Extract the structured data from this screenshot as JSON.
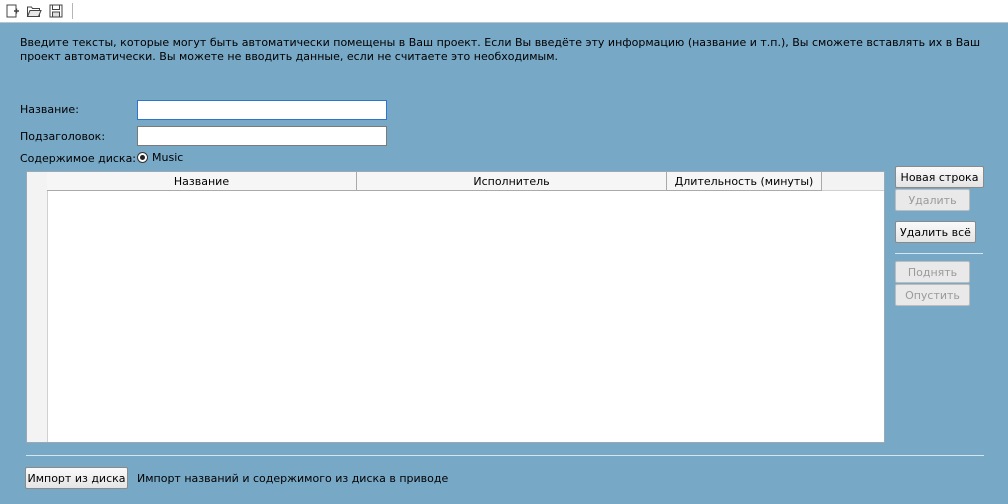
{
  "toolbar": {
    "buttons": [
      {
        "icon": "new-project-icon"
      },
      {
        "icon": "open-folder-icon"
      },
      {
        "icon": "save-icon"
      }
    ]
  },
  "intro": {
    "text": "Введите тексты, которые могут быть автоматически помещены в Ваш проект. Если Вы введёте эту информацию (название и т.п.), Вы сможете вставлять их в Ваш проект автоматически. Вы можете не вводить данные, если не считаете это необходимым."
  },
  "form": {
    "title_label": "Название:",
    "title_value": "",
    "subtitle_label": "Подзаголовок:",
    "subtitle_value": "",
    "disc_content_label": "Содержимое диска:",
    "disc_content_option": "Music"
  },
  "table": {
    "columns": [
      "Название",
      "Исполнитель",
      "Длительность (минуты)"
    ],
    "rows": []
  },
  "buttons": {
    "new_row": "Новая строка",
    "delete": "Удалить",
    "delete_all": "Удалить всё",
    "move_up": "Поднять",
    "move_down": "Опустить",
    "import": "Импорт из диска"
  },
  "footer": {
    "import_desc": "Импорт названий и содержимого из диска в приводе"
  },
  "colors": {
    "background": "#77a8c6",
    "focus_border": "#2f74d0"
  }
}
